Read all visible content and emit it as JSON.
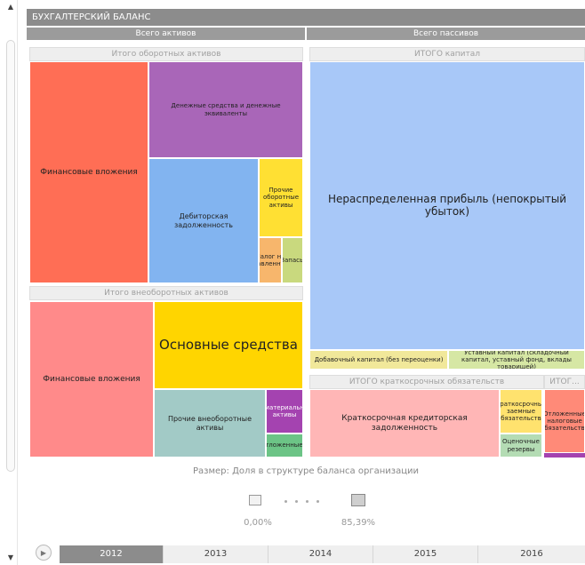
{
  "title": "БУХГАЛТЕРСКИЙ БАЛАНС",
  "assets": {
    "header": "Всего активов",
    "current": {
      "header": "Итого оборотных активов",
      "tiles": {
        "fin_invest": "Финансовые вложения",
        "cash": "Денежные средства и денежные эквиваленты",
        "receivables": "Дебиторская задолженность",
        "other": "Прочие оборотные активы",
        "vat": "Налог на добавленную...",
        "inventory": "Запасы"
      }
    },
    "noncurrent": {
      "header": "Итого внеоборотных активов",
      "tiles": {
        "fin_invest": "Финансовые вложения",
        "fixed": "Основные средства",
        "other": "Прочие внеоборотные активы",
        "intangible": "Нематериальные активы",
        "deferred": "Отложенные..."
      }
    }
  },
  "liabilities": {
    "header": "Всего пассивов",
    "capital": {
      "header": "ИТОГО капитал",
      "tiles": {
        "retained": "Нераспределенная прибыль (непокрытый убыток)",
        "additional": "Добавочный капитал (без переоценки)",
        "charter": "Уставный капитал (складочный капитал, уставный фонд, вклады товарищей)"
      }
    },
    "short_term": {
      "header": "ИТОГО краткосрочных обязательств",
      "tiles": {
        "payables": "Краткосрочная кредиторская задолженность",
        "loans": "Краткосрочные заемные обязательства",
        "reserves": "Оценочные резервы"
      }
    },
    "long_term": {
      "header": "ИТОГ...",
      "tiles": {
        "deferred": "Отложенные налоговые обязательства"
      }
    }
  },
  "size_caption": "Размер: Доля в структуре баланса организации",
  "legend": {
    "min": "0,00%",
    "max": "85,39%"
  },
  "years": [
    "2012",
    "2013",
    "2014",
    "2015",
    "2016"
  ],
  "selected_year": "2012",
  "colors": {
    "orange_red": "#ff6e55",
    "purple": "#a966b8",
    "blue": "#82b4f0",
    "yellow": "#ffe033",
    "light_orange": "#f7b66c",
    "light_green": "#c9d97e",
    "pink": "#ff8a8a",
    "gold": "#ffd500",
    "teal": "#a2cac6",
    "violet": "#a443b0",
    "green": "#6cc486",
    "light_blue": "#a8c8f8",
    "pale_yellow": "#f1e89a",
    "pale_green": "#d6e7a4",
    "light_pink": "#ffb6b6",
    "amber": "#ffe26e",
    "mint": "#b4dcb4",
    "salmon": "#ff8a78"
  }
}
